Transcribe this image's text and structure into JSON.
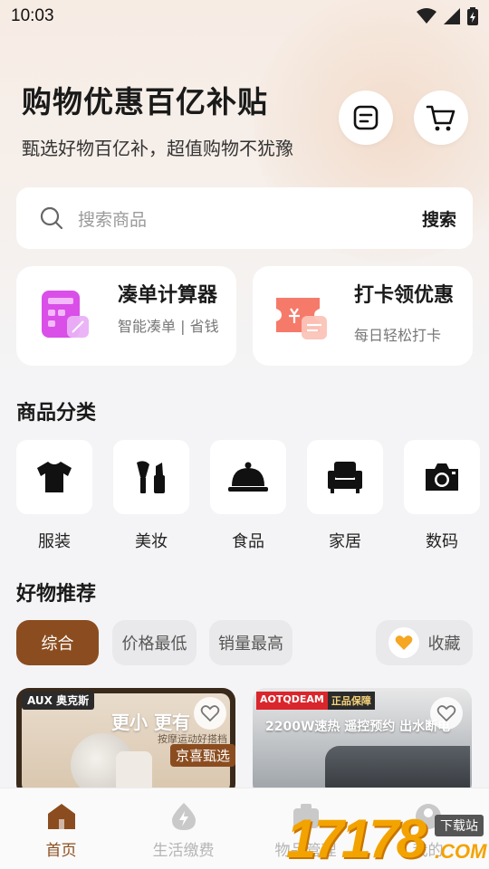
{
  "status": {
    "time": "10:03"
  },
  "header": {
    "title": "购物优惠百亿补贴",
    "subtitle": "甄选好物百亿补，超值购物不犹豫"
  },
  "search": {
    "placeholder": "搜索商品",
    "button": "搜索"
  },
  "features": [
    {
      "title": "凑单计算器",
      "desc": "智能凑单 | 省钱",
      "icon": "calculator-icon",
      "color": "#d94fe8"
    },
    {
      "title": "打卡领优惠",
      "desc": "每日轻松打卡",
      "icon": "ticket-icon",
      "color": "#f57a6a"
    }
  ],
  "categories": {
    "title": "商品分类",
    "items": [
      {
        "label": "服装",
        "icon": "tshirt-icon"
      },
      {
        "label": "美妆",
        "icon": "makeup-icon"
      },
      {
        "label": "食品",
        "icon": "food-cloche-icon"
      },
      {
        "label": "家居",
        "icon": "armchair-icon"
      },
      {
        "label": "数码",
        "icon": "camera-icon"
      }
    ]
  },
  "recommend": {
    "title": "好物推荐",
    "filters": [
      "综合",
      "价格最低",
      "销量最高"
    ],
    "favorites": "收藏"
  },
  "products": [
    {
      "brand": "AUX 奥克斯",
      "headline": "更小 更有",
      "sub": "按摩运动好搭档",
      "tag": "京喜甄选"
    },
    {
      "brand": "AOTQDEAM",
      "badge": "正品保障",
      "headline": "2200W速热  遥控预约 出水断电"
    }
  ],
  "nav": {
    "items": [
      {
        "label": "首页",
        "active": true
      },
      {
        "label": "生活缴费",
        "active": false
      },
      {
        "label": "物品管理",
        "active": false
      },
      {
        "label": "我的",
        "active": false
      }
    ]
  },
  "watermark": {
    "text": "17178",
    "suffix": ".COM",
    "tag": "下载站"
  },
  "colors": {
    "accent": "#8b4d1f",
    "favorite": "#f5a623"
  }
}
